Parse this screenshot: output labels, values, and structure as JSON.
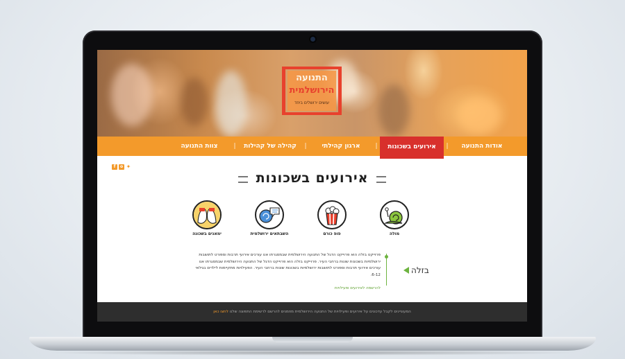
{
  "site": {
    "logo": {
      "line1": "התנועה",
      "line2": "הירושלמית",
      "tagline": "עושים ירושלים ביחד"
    },
    "nav": {
      "items": [
        {
          "label": "אודות התנועה",
          "active": false
        },
        {
          "label": "אירועים בשכונות",
          "active": true
        },
        {
          "label": "ארגון קהילתי",
          "active": false
        },
        {
          "label": "קהילה של קהילות",
          "active": false
        },
        {
          "label": "צוות התנועה",
          "active": false
        }
      ]
    },
    "social": [
      "facebook-icon",
      "instagram-icon",
      "twitter-icon"
    ],
    "page_title": "אירועים בשכונות",
    "categories": [
      {
        "label": "מולה",
        "icon": "snail-icon"
      },
      {
        "label": "פופ כורם",
        "icon": "popcorn-icon"
      },
      {
        "label": "השבתאים ירושלמית",
        "icon": "speech-bubbles-icon"
      },
      {
        "label": "ימאנים בשכונה",
        "icon": "people-faces-icon"
      }
    ],
    "selected_category": "בזלה",
    "description": "פרוייקט בזלה הוא פרוייקט הדגל של התנועה הירושלמית שבמסגרתו אנו עורכים אירועי תרבות וספורט לתושבות ירושלמיות בשכונות שונות ברחבי העיר. פרוייקט בזלה הוא פרוייקט הדגל של התנועה הירושלמית שבמסגרתו אנו עורכים אירועי תרבות וספורט לתושבות ירושלמיות בשכונות שונות ברחבי העיר. הפעילויות מתקיימות לילדים בגילאי 6-12.",
    "more_link": "להרשמה לאירועים ופעילויות",
    "footer_text": "המעוניינים לקבל עדכונים על אירועים ופעילויות של התנועה הירושלמית מוזמנים להרשם לרשימת התפוצה שלנו",
    "footer_link": "לחצו כאן",
    "colors": {
      "accent": "#f39a2b",
      "active_tab": "#d8302c",
      "link_green": "#6db33f",
      "footer_bg": "#2e2e2e"
    }
  }
}
